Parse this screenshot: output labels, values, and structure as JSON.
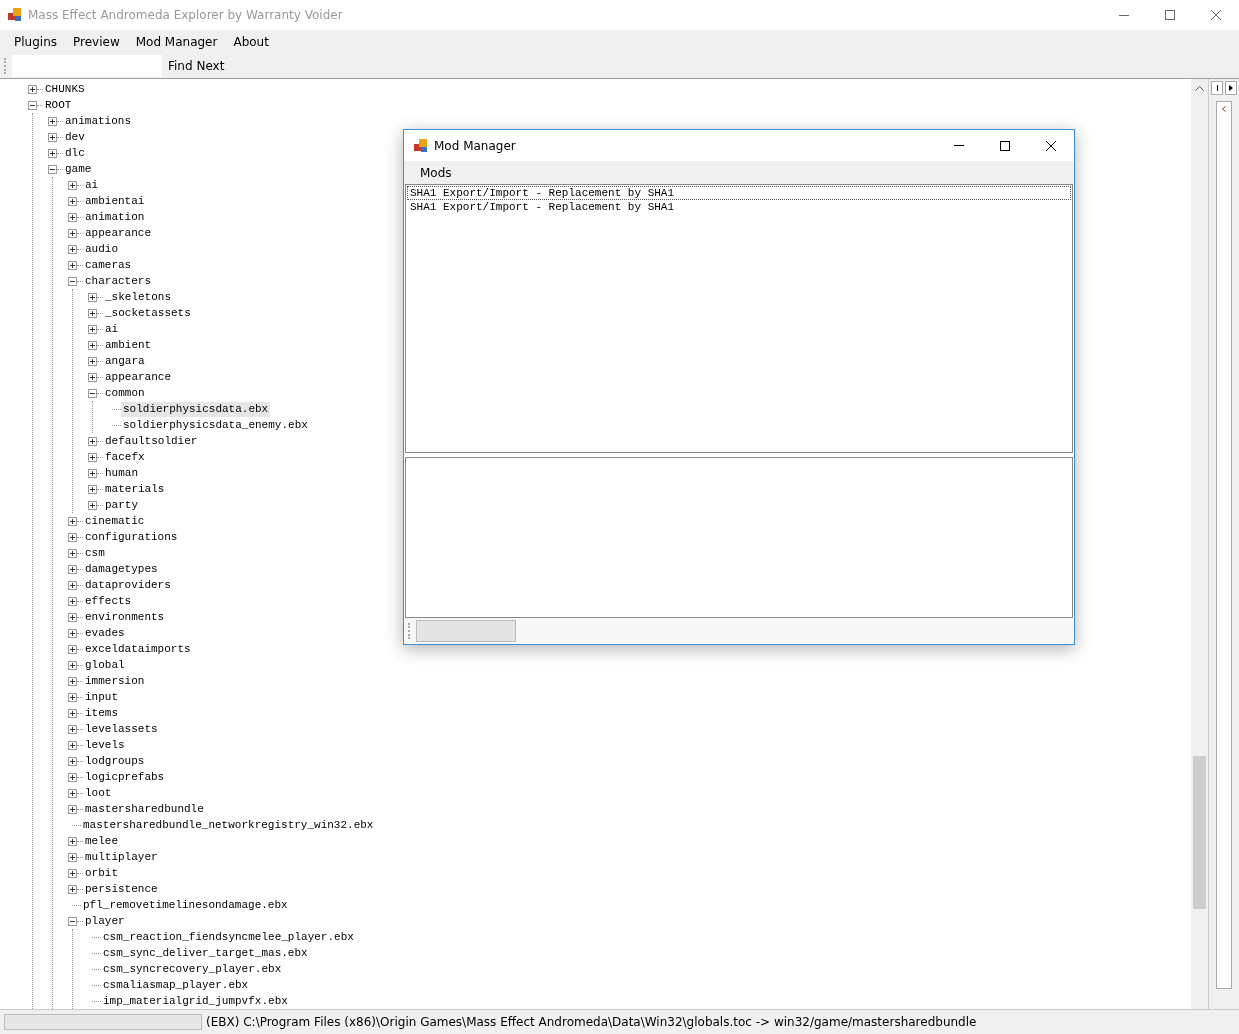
{
  "window": {
    "title": "Mass Effect Andromeda Explorer by Warranty Voider"
  },
  "menu": [
    "Plugins",
    "Preview",
    "Mod Manager",
    "About"
  ],
  "toolbar": {
    "find_button": "Find Next"
  },
  "tree": [
    {
      "label": "CHUNKS",
      "expanded": false,
      "selected": false
    },
    {
      "label": "ROOT",
      "expanded": true,
      "selected": false,
      "children": [
        {
          "label": "animations",
          "expanded": false,
          "selected": false
        },
        {
          "label": "dev",
          "expanded": false,
          "selected": false
        },
        {
          "label": "dlc",
          "expanded": false,
          "selected": false
        },
        {
          "label": "game",
          "expanded": true,
          "selected": false,
          "children": [
            {
              "label": "ai",
              "expanded": false,
              "selected": false
            },
            {
              "label": "ambientai",
              "expanded": false,
              "selected": false
            },
            {
              "label": "animation",
              "expanded": false,
              "selected": false
            },
            {
              "label": "appearance",
              "expanded": false,
              "selected": false
            },
            {
              "label": "audio",
              "expanded": false,
              "selected": false
            },
            {
              "label": "cameras",
              "expanded": false,
              "selected": false
            },
            {
              "label": "characters",
              "expanded": true,
              "selected": false,
              "children": [
                {
                  "label": "_skeletons",
                  "expanded": false,
                  "selected": false
                },
                {
                  "label": "_socketassets",
                  "expanded": false,
                  "selected": false
                },
                {
                  "label": "ai",
                  "expanded": false,
                  "selected": false
                },
                {
                  "label": "ambient",
                  "expanded": false,
                  "selected": false
                },
                {
                  "label": "angara",
                  "expanded": false,
                  "selected": false
                },
                {
                  "label": "appearance",
                  "expanded": false,
                  "selected": false
                },
                {
                  "label": "common",
                  "expanded": true,
                  "selected": false,
                  "children": [
                    {
                      "label": "soldierphysicsdata.ebx",
                      "selected": true
                    },
                    {
                      "label": "soldierphysicsdata_enemy.ebx",
                      "selected": false
                    }
                  ]
                },
                {
                  "label": "defaultsoldier",
                  "expanded": false,
                  "selected": false
                },
                {
                  "label": "facefx",
                  "expanded": false,
                  "selected": false
                },
                {
                  "label": "human",
                  "expanded": false,
                  "selected": false
                },
                {
                  "label": "materials",
                  "expanded": false,
                  "selected": false
                },
                {
                  "label": "party",
                  "expanded": false,
                  "selected": false
                }
              ]
            },
            {
              "label": "cinematic",
              "expanded": false,
              "selected": false
            },
            {
              "label": "configurations",
              "expanded": false,
              "selected": false
            },
            {
              "label": "csm",
              "expanded": false,
              "selected": false
            },
            {
              "label": "damagetypes",
              "expanded": false,
              "selected": false
            },
            {
              "label": "dataproviders",
              "expanded": false,
              "selected": false
            },
            {
              "label": "effects",
              "expanded": false,
              "selected": false
            },
            {
              "label": "environments",
              "expanded": false,
              "selected": false
            },
            {
              "label": "evades",
              "expanded": false,
              "selected": false
            },
            {
              "label": "exceldataimports",
              "expanded": false,
              "selected": false
            },
            {
              "label": "global",
              "expanded": false,
              "selected": false
            },
            {
              "label": "immersion",
              "expanded": false,
              "selected": false
            },
            {
              "label": "input",
              "expanded": false,
              "selected": false
            },
            {
              "label": "items",
              "expanded": false,
              "selected": false
            },
            {
              "label": "levelassets",
              "expanded": false,
              "selected": false
            },
            {
              "label": "levels",
              "expanded": false,
              "selected": false
            },
            {
              "label": "lodgroups",
              "expanded": false,
              "selected": false
            },
            {
              "label": "logicprefabs",
              "expanded": false,
              "selected": false
            },
            {
              "label": "loot",
              "expanded": false,
              "selected": false
            },
            {
              "label": "mastersharedbundle",
              "expanded": false,
              "selected": false
            },
            {
              "label": "mastersharedbundle_networkregistry_win32.ebx",
              "selected": false
            },
            {
              "label": "melee",
              "expanded": false,
              "selected": false
            },
            {
              "label": "multiplayer",
              "expanded": false,
              "selected": false
            },
            {
              "label": "orbit",
              "expanded": false,
              "selected": false
            },
            {
              "label": "persistence",
              "expanded": false,
              "selected": false
            },
            {
              "label": "pfl_removetimelinesondamage.ebx",
              "selected": false
            },
            {
              "label": "player",
              "expanded": true,
              "selected": false,
              "children": [
                {
                  "label": "csm_reaction_fiendsyncmelee_player.ebx",
                  "selected": false
                },
                {
                  "label": "csm_sync_deliver_target_mas.ebx",
                  "selected": false
                },
                {
                  "label": "csm_syncrecovery_player.ebx",
                  "selected": false
                },
                {
                  "label": "csmaliasmap_player.ebx",
                  "selected": false
                },
                {
                  "label": "imp_materialgrid_jumpvfx.ebx",
                  "selected": false
                }
              ]
            }
          ]
        }
      ]
    }
  ],
  "status_bar": {
    "text": "(EBX) C:\\Program Files (x86)\\Origin Games\\Mass Effect Andromeda\\Data\\Win32\\globals.toc -> win32/game/mastersharedbundle"
  },
  "mod_manager": {
    "title": "Mod Manager",
    "menu": [
      "Mods"
    ],
    "mods": [
      {
        "label": "SHA1 Export/Import - Replacement by SHA1",
        "selected": true
      },
      {
        "label": "SHA1 Export/Import - Replacement by SHA1",
        "selected": false
      }
    ]
  }
}
